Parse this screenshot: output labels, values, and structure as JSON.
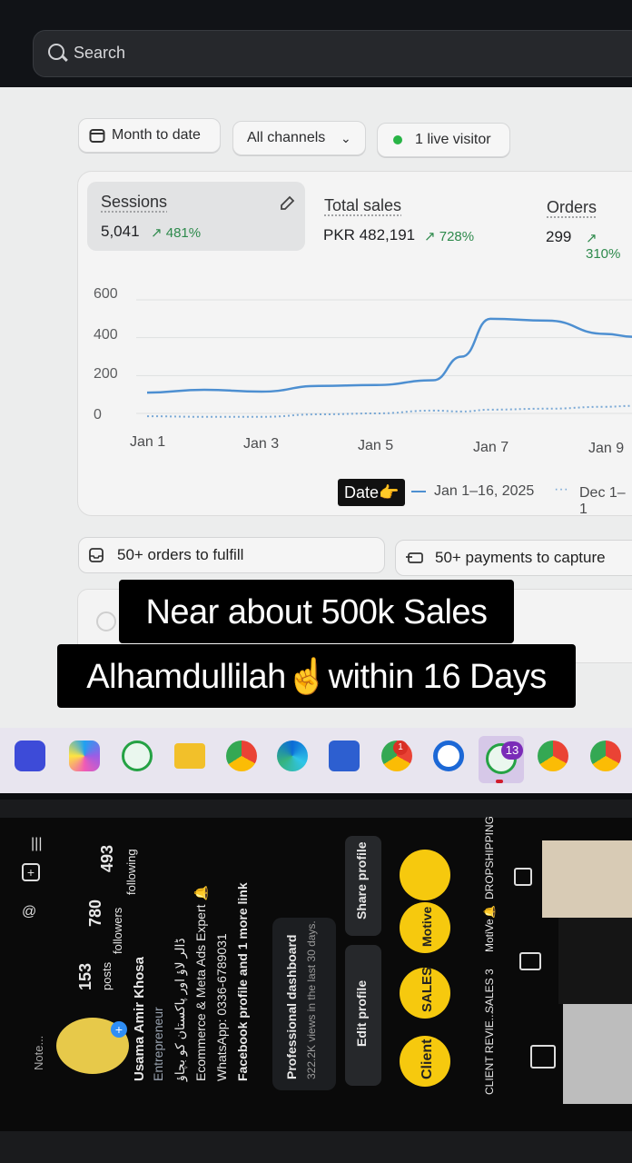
{
  "search": {
    "placeholder": "Search"
  },
  "filters": {
    "date_range": "Month to date",
    "channels": "All channels",
    "live_visitors": "1 live visitor"
  },
  "metrics": [
    {
      "title": "Sessions",
      "value": "5,041",
      "change": "481%"
    },
    {
      "title": "Total sales",
      "value": "PKR 482,191",
      "change": "728%"
    },
    {
      "title": "Orders",
      "value": "299",
      "change": "310%"
    }
  ],
  "chart_data": {
    "type": "line",
    "x_ticks": [
      "Jan 1",
      "Jan 3",
      "Jan 5",
      "Jan 7",
      "Jan 9"
    ],
    "y_ticks": [
      "600",
      "400",
      "200",
      "0"
    ],
    "ylim": [
      0,
      600
    ],
    "x": [
      1,
      2,
      3,
      4,
      5,
      6,
      6.5,
      7,
      8,
      9,
      9.5
    ],
    "series": [
      {
        "name": "Jan 1–16, 2025",
        "style": "solid",
        "color": "#4d8fd1",
        "values": [
          110,
          125,
          115,
          145,
          150,
          175,
          300,
          500,
          490,
          420,
          405
        ]
      },
      {
        "name": "Dec 1–1",
        "style": "dotted",
        "color": "#7aa9d6",
        "values": [
          -15,
          -18,
          -18,
          -5,
          0,
          15,
          10,
          20,
          25,
          35,
          40
        ]
      }
    ]
  },
  "legend": {
    "date_tag": "Date👉",
    "current": "Jan 1–16, 2025",
    "previous": "Dec 1–1"
  },
  "tasks": {
    "orders": "50+ orders to fulfill",
    "payments": "50+ payments to capture"
  },
  "caption": {
    "line1": "Near about 500k Sales",
    "line2": "Alhamdullilah☝️within 16 Days"
  },
  "taskbar": {
    "whatsapp_badge": "13",
    "chrome_badge": "1"
  },
  "instagram": {
    "note": "Note...",
    "posts_count": "153",
    "posts_label": "posts",
    "followers_count": "780",
    "followers_label": "followers",
    "following_count": "493",
    "following_label": "following",
    "name": "Usama Amir Khosa",
    "category": "Entrepreneur",
    "bio_urdu": "ڈالر لاؤ اور پاکستان کو بچاؤ",
    "bio_line1": "Ecommerce & Meta Ads Expert 🔔",
    "bio_line2": "WhatsApp: 0336-6789031",
    "bio_line3": "Facebook profile and 1 more link",
    "dashboard_title": "Professional dashboard",
    "dashboard_sub": "322.2K views in the last 30 days.",
    "edit_profile": "Edit profile",
    "share_profile": "Share profile",
    "highlights": [
      "CLIENT REVIE...",
      "SALES 3",
      "MotiVe🔔",
      "DROPSHIPPING"
    ],
    "highlight_covers": [
      "Client",
      "SALES",
      "Motive",
      ""
    ]
  }
}
